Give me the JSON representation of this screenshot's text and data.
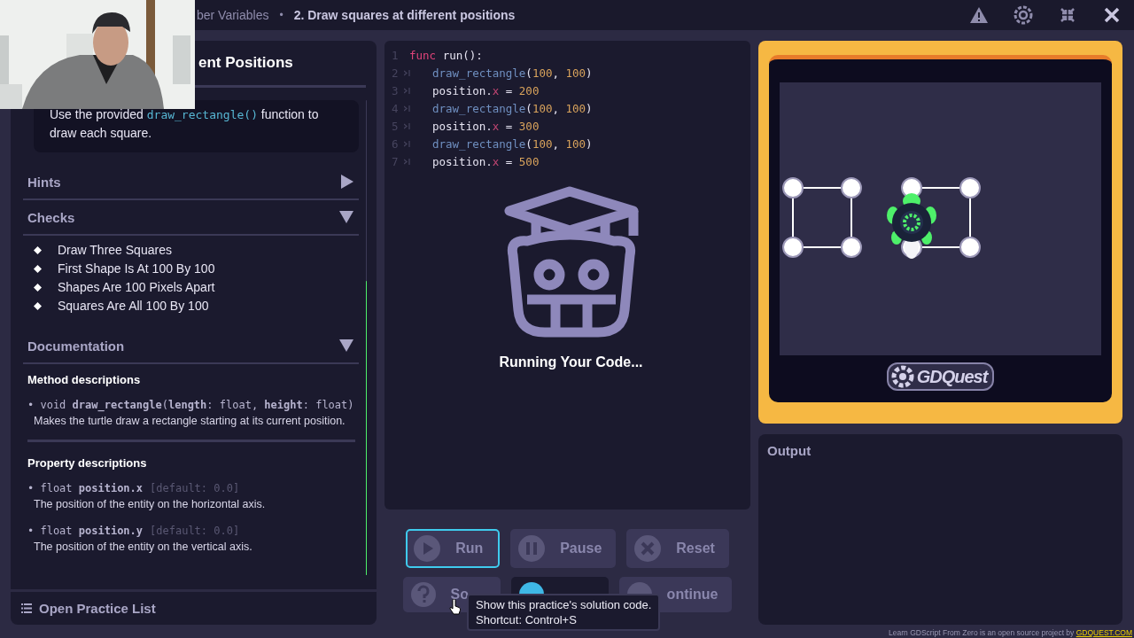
{
  "webcam": {
    "kind": "picture"
  },
  "breadcrumb": {
    "items": [
      {
        "text": "ber Variables",
        "current": false
      },
      {
        "text": "2. Draw squares at different positions",
        "current": true
      }
    ],
    "separator": "•"
  },
  "window_controls": [
    {
      "kind": "warning"
    },
    {
      "kind": "settings"
    },
    {
      "kind": "collapse"
    },
    {
      "kind": "close"
    }
  ],
  "lesson": {
    "title": "ent Positions",
    "instructions": {
      "before": "Use the provided ",
      "code": "draw_rectangle()",
      "after": " function to draw each square."
    },
    "sections": [
      {
        "title": "Hints",
        "expanded": false
      },
      {
        "title": "Checks",
        "expanded": true,
        "items": [
          "Draw Three Squares",
          "First Shape Is At 100 By 100",
          "Shapes Are 100 Pixels Apart",
          "Squares Are All 100 By 100"
        ]
      },
      {
        "title": "Documentation",
        "expanded": true
      }
    ],
    "documentation": {
      "method_heading": "Method descriptions",
      "methods": [
        {
          "signature": "• void **draw_rectangle**(**length**: float, **height**: float)",
          "description": "Makes the turtle draw a rectangle starting at its current position."
        }
      ],
      "property_heading": "Property descriptions",
      "properties": [
        {
          "signature": "• float **position.x**",
          "default": "[default: 0.0]",
          "description": "The position of the entity on the horizontal axis."
        },
        {
          "signature": "• float **position.y**",
          "default": "[default: 0.0]",
          "description": "The position of the entity on the vertical axis."
        }
      ]
    },
    "footer": {
      "label": "Open Practice List"
    }
  },
  "code": {
    "lines": [
      {
        "number": "1",
        "tab": false,
        "tokens": [
          {
            "kind": "keyword",
            "text": "func"
          },
          {
            "kind": "plain",
            "text": " run():"
          }
        ]
      },
      {
        "number": "2",
        "tab": true,
        "tokens": [
          {
            "kind": "function",
            "text": "draw_rectangle"
          },
          {
            "kind": "plain",
            "text": "("
          },
          {
            "kind": "number",
            "text": "100"
          },
          {
            "kind": "plain",
            "text": ", "
          },
          {
            "kind": "number",
            "text": "100"
          },
          {
            "kind": "plain",
            "text": ")"
          }
        ]
      },
      {
        "number": "3",
        "tab": true,
        "tokens": [
          {
            "kind": "plain",
            "text": "position."
          },
          {
            "kind": "member",
            "text": "x"
          },
          {
            "kind": "plain",
            "text": " = "
          },
          {
            "kind": "number",
            "text": "200"
          }
        ]
      },
      {
        "number": "4",
        "tab": true,
        "tokens": [
          {
            "kind": "function",
            "text": "draw_rectangle"
          },
          {
            "kind": "plain",
            "text": "("
          },
          {
            "kind": "number",
            "text": "100"
          },
          {
            "kind": "plain",
            "text": ", "
          },
          {
            "kind": "number",
            "text": "100"
          },
          {
            "kind": "plain",
            "text": ")"
          }
        ]
      },
      {
        "number": "5",
        "tab": true,
        "tokens": [
          {
            "kind": "plain",
            "text": "position."
          },
          {
            "kind": "member",
            "text": "x"
          },
          {
            "kind": "plain",
            "text": " = "
          },
          {
            "kind": "number",
            "text": "300"
          }
        ]
      },
      {
        "number": "6",
        "tab": true,
        "tokens": [
          {
            "kind": "function",
            "text": "draw_rectangle"
          },
          {
            "kind": "plain",
            "text": "("
          },
          {
            "kind": "number",
            "text": "100"
          },
          {
            "kind": "plain",
            "text": ", "
          },
          {
            "kind": "number",
            "text": "100"
          },
          {
            "kind": "plain",
            "text": ")"
          }
        ]
      },
      {
        "number": "7",
        "tab": true,
        "tokens": [
          {
            "kind": "plain",
            "text": "position."
          },
          {
            "kind": "member",
            "text": "x"
          },
          {
            "kind": "plain",
            "text": " = "
          },
          {
            "kind": "number",
            "text": "500"
          }
        ]
      }
    ],
    "status": "Running Your Code..."
  },
  "controls": [
    [
      {
        "label": "Run",
        "kind": "play",
        "focused": true,
        "highlighted": false
      },
      {
        "label": "Pause",
        "kind": "pause",
        "focused": false,
        "highlighted": false
      },
      {
        "label": "Reset",
        "kind": "reset",
        "focused": false,
        "highlighted": false
      }
    ],
    [
      {
        "label": "So",
        "kind": "help",
        "focused": false,
        "highlighted": false
      },
      {
        "kind": "circle",
        "focused": false,
        "highlighted": true
      },
      {
        "label": "ontinue",
        "kind": "circle",
        "focused": false,
        "highlighted": false
      }
    ]
  ],
  "viewport": {
    "logo": "GDQuest"
  },
  "output": {
    "title": "Output"
  },
  "tooltip": {
    "lines": [
      "Show this practice's solution code.",
      "Shortcut: Control+S"
    ]
  },
  "credit": {
    "text": "Learn GDScript From Zero is an open source project by ",
    "link": "GDQUEST.COM"
  }
}
